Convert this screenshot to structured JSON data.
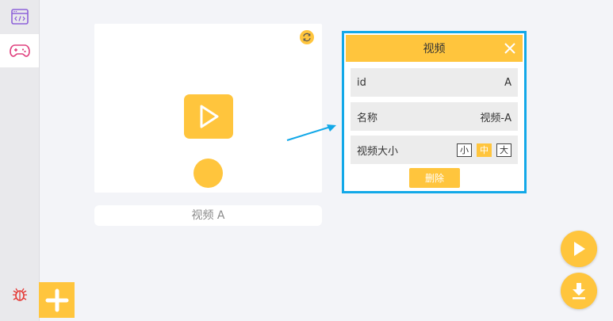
{
  "sidebar": {
    "items": [
      {
        "name": "code",
        "icon": "code-window-icon"
      },
      {
        "name": "game",
        "icon": "gamepad-icon",
        "active": true
      },
      {
        "name": "debug",
        "icon": "bug-icon"
      }
    ]
  },
  "stage": {
    "sprite_name": "视频 A",
    "refresh_icon": "refresh-icon",
    "video_icon": "play-icon"
  },
  "panel": {
    "title": "视频",
    "rows": [
      {
        "label": "id",
        "value": "A"
      },
      {
        "label": "名称",
        "value": "视频-A"
      },
      {
        "label": "视频大小"
      }
    ],
    "size_options": [
      "小",
      "中",
      "大"
    ],
    "size_selected": "中",
    "delete_label": "删除"
  },
  "colors": {
    "accent": "#ffc53d",
    "highlight": "#12a8e8",
    "background": "#f3f4f8"
  }
}
